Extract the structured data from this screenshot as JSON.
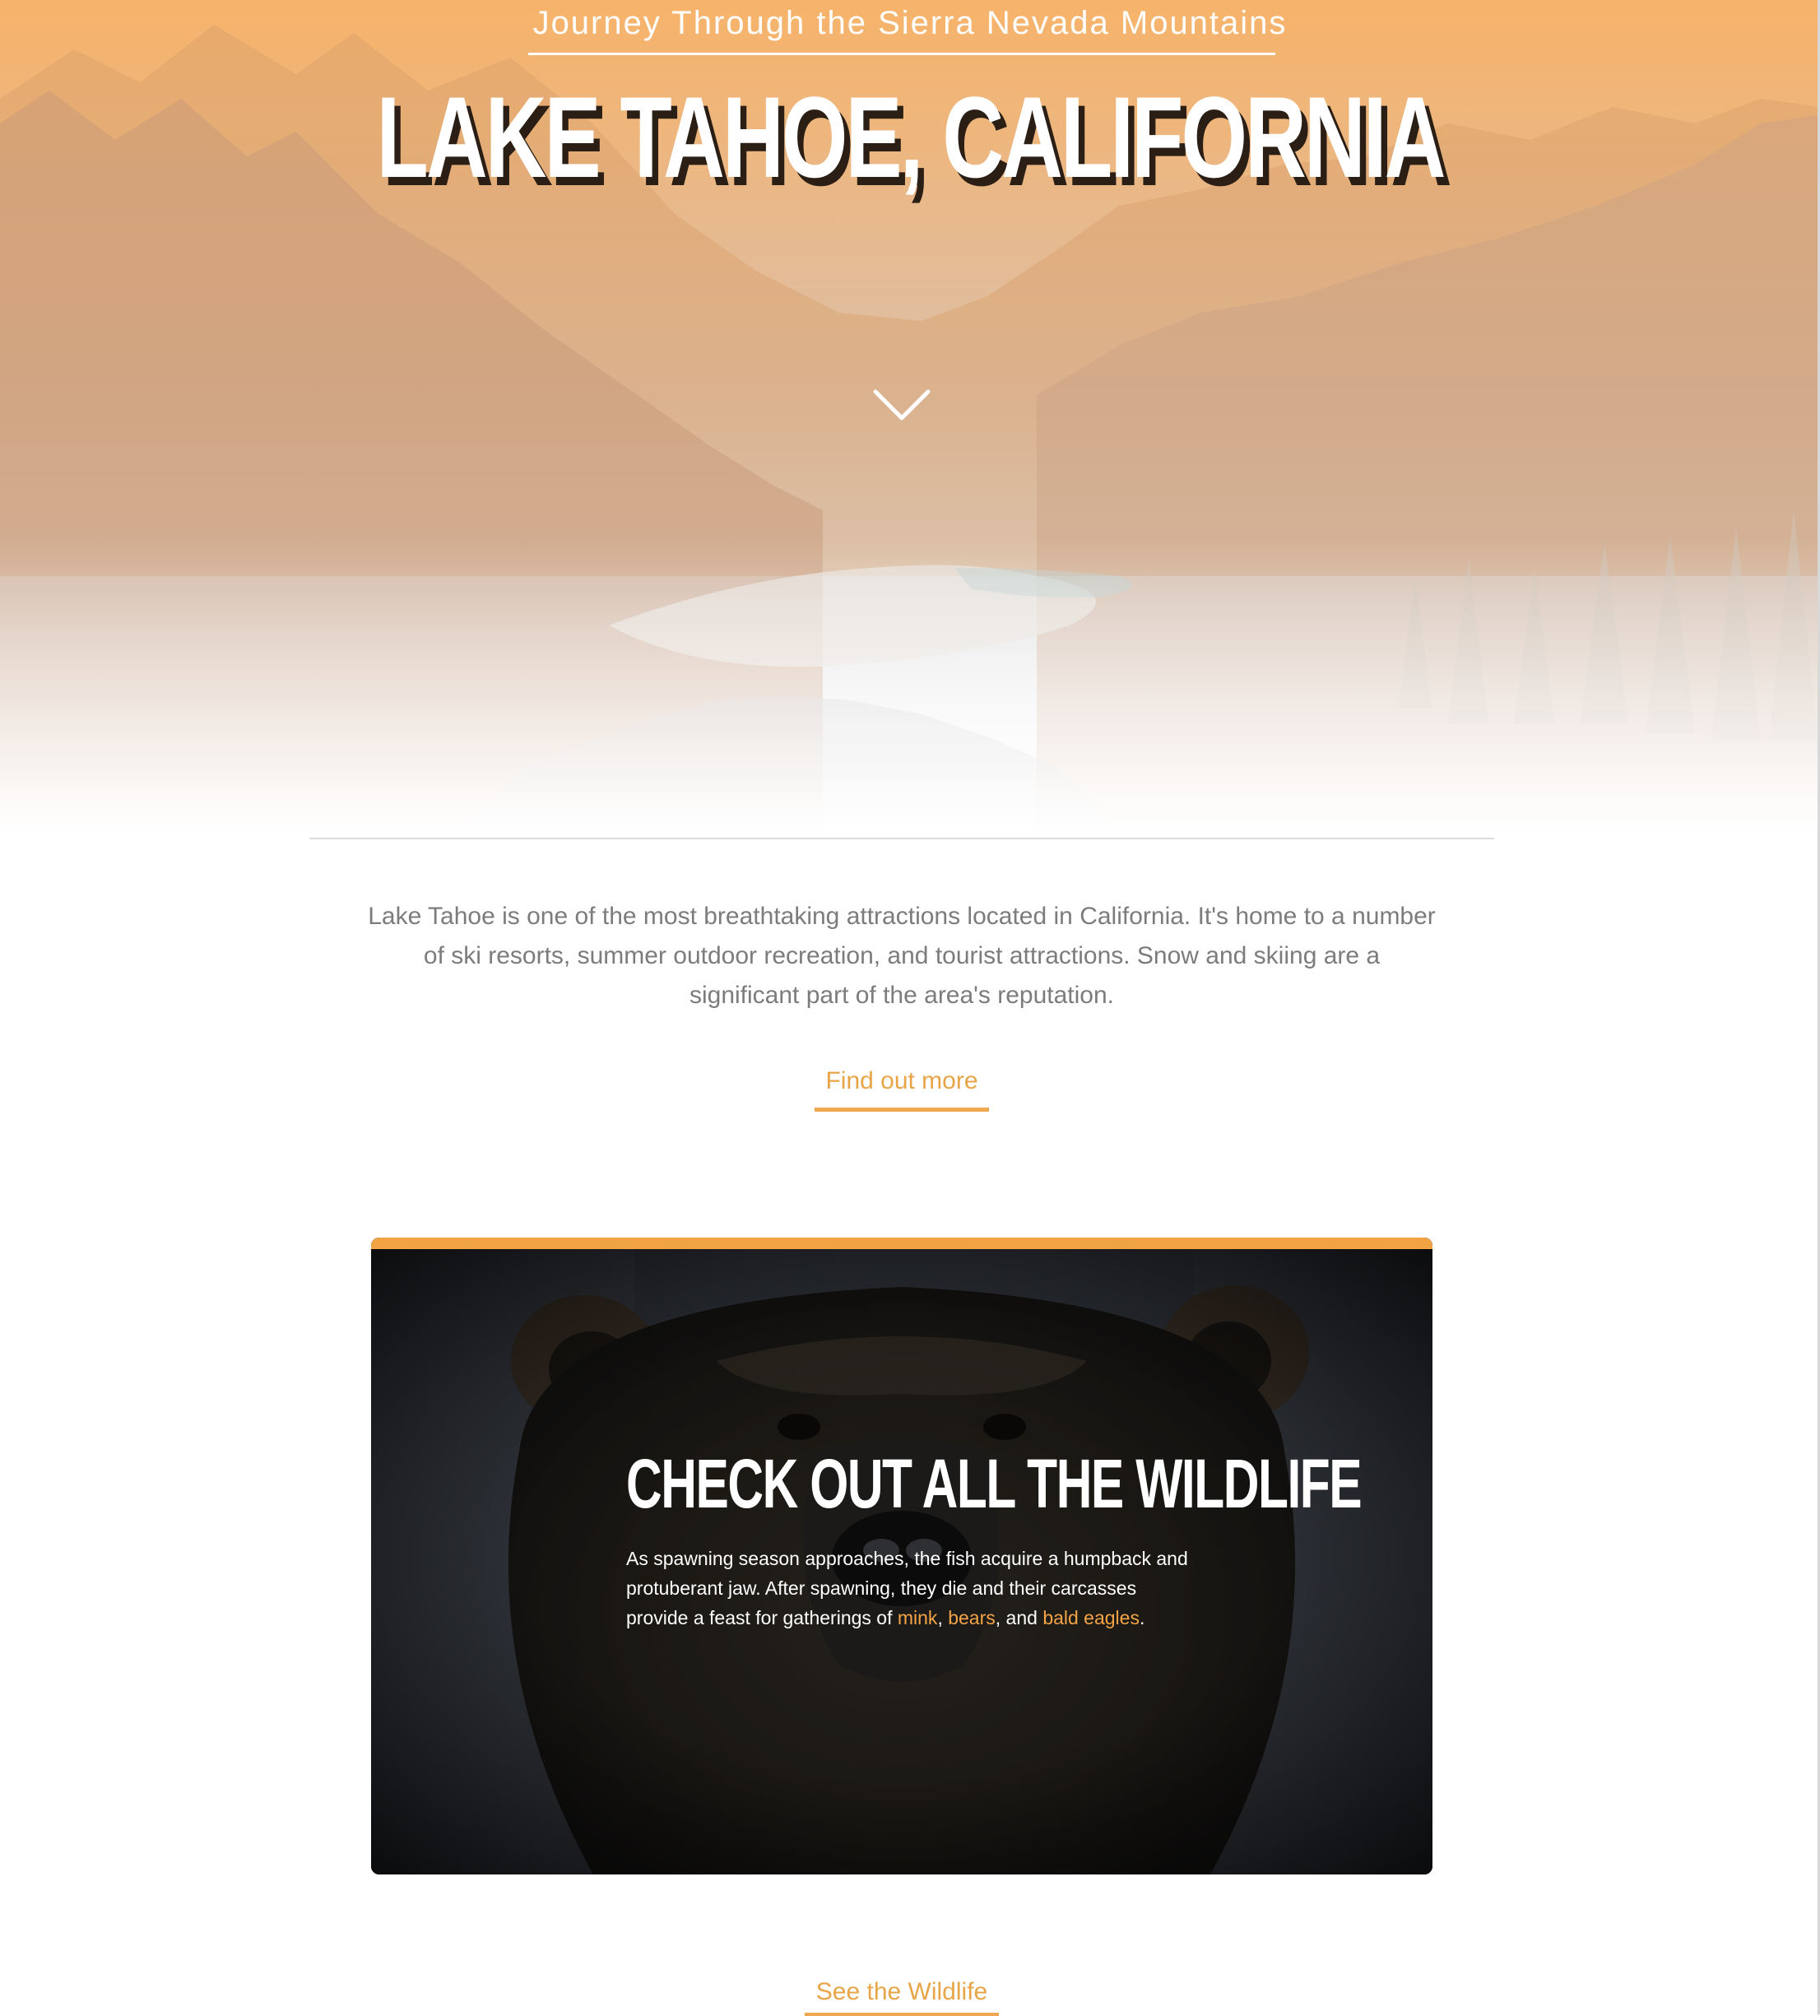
{
  "hero": {
    "subtitle": "Journey Through the Sierra Nevada Mountains",
    "title": "LAKE TAHOE, CALIFORNIA",
    "scroll_icon": "chevron-down-icon"
  },
  "intro": {
    "paragraph": "Lake Tahoe is one of the most breathtaking attractions located in California. It's home to a number of ski resorts, summer outdoor recreation, and tourist attractions. Snow and skiing are a significant part of the area's reputation.",
    "cta_label": "Find out more"
  },
  "wildlife_card": {
    "heading": "CHECK OUT ALL THE WILDLIFE",
    "body_text": "As spawning season approaches, the fish acquire a humpback and protuberant jaw. After spawning, they die and their carcasses provide a feast for gatherings of",
    "link_mink": "mink",
    "separator_1": ",",
    "link_bears": "bears",
    "separator_2": ", and",
    "link_bald_eagles": "bald eagles",
    "terminator": ".",
    "cta_label": "See the Wildlife"
  },
  "colors": {
    "accent": "#f2a444",
    "link": "#e8a548",
    "body_text": "#7c7c7c",
    "card_background": "#1e2024"
  }
}
